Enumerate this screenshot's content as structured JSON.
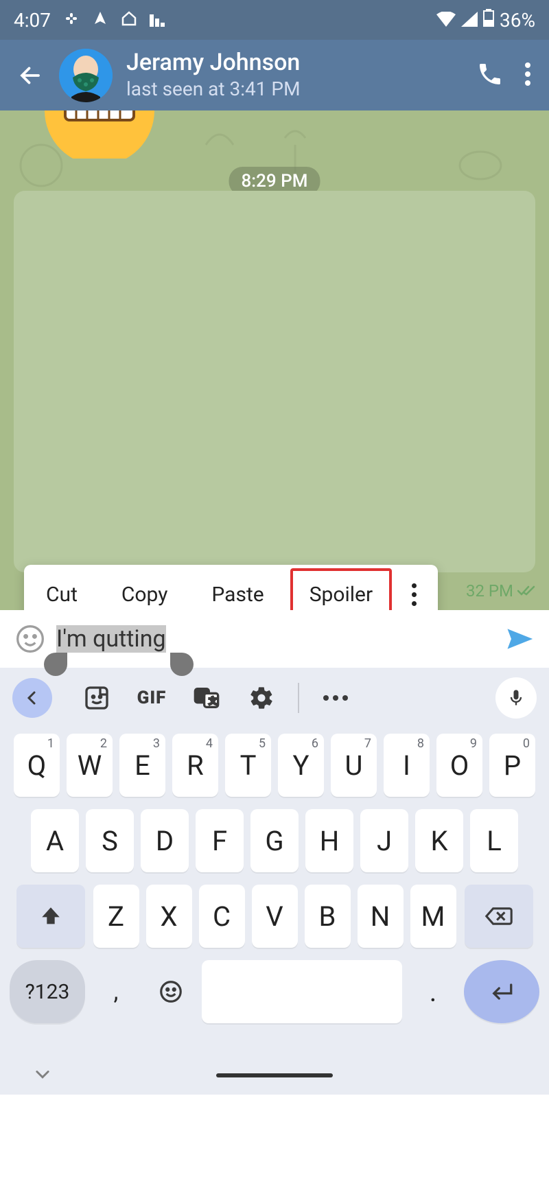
{
  "status": {
    "time": "4:07",
    "battery": "36%"
  },
  "header": {
    "contact_name": "Jeramy Johnson",
    "last_seen": "last seen at 3:41 PM"
  },
  "chat": {
    "date_label": "8:29 PM",
    "msg_time": "32 PM"
  },
  "context_menu": {
    "cut": "Cut",
    "copy": "Copy",
    "paste": "Paste",
    "spoiler": "Spoiler"
  },
  "input": {
    "text": "I'm qutting"
  },
  "keyboard": {
    "gif_label": "GIF",
    "row1": [
      {
        "k": "Q",
        "n": "1"
      },
      {
        "k": "W",
        "n": "2"
      },
      {
        "k": "E",
        "n": "3"
      },
      {
        "k": "R",
        "n": "4"
      },
      {
        "k": "T",
        "n": "5"
      },
      {
        "k": "Y",
        "n": "6"
      },
      {
        "k": "U",
        "n": "7"
      },
      {
        "k": "I",
        "n": "8"
      },
      {
        "k": "O",
        "n": "9"
      },
      {
        "k": "P",
        "n": "0"
      }
    ],
    "row2": [
      "A",
      "S",
      "D",
      "F",
      "G",
      "H",
      "J",
      "K",
      "L"
    ],
    "row3": [
      "Z",
      "X",
      "C",
      "V",
      "B",
      "N",
      "M"
    ],
    "sym": "?123",
    "comma": ",",
    "period": "."
  }
}
